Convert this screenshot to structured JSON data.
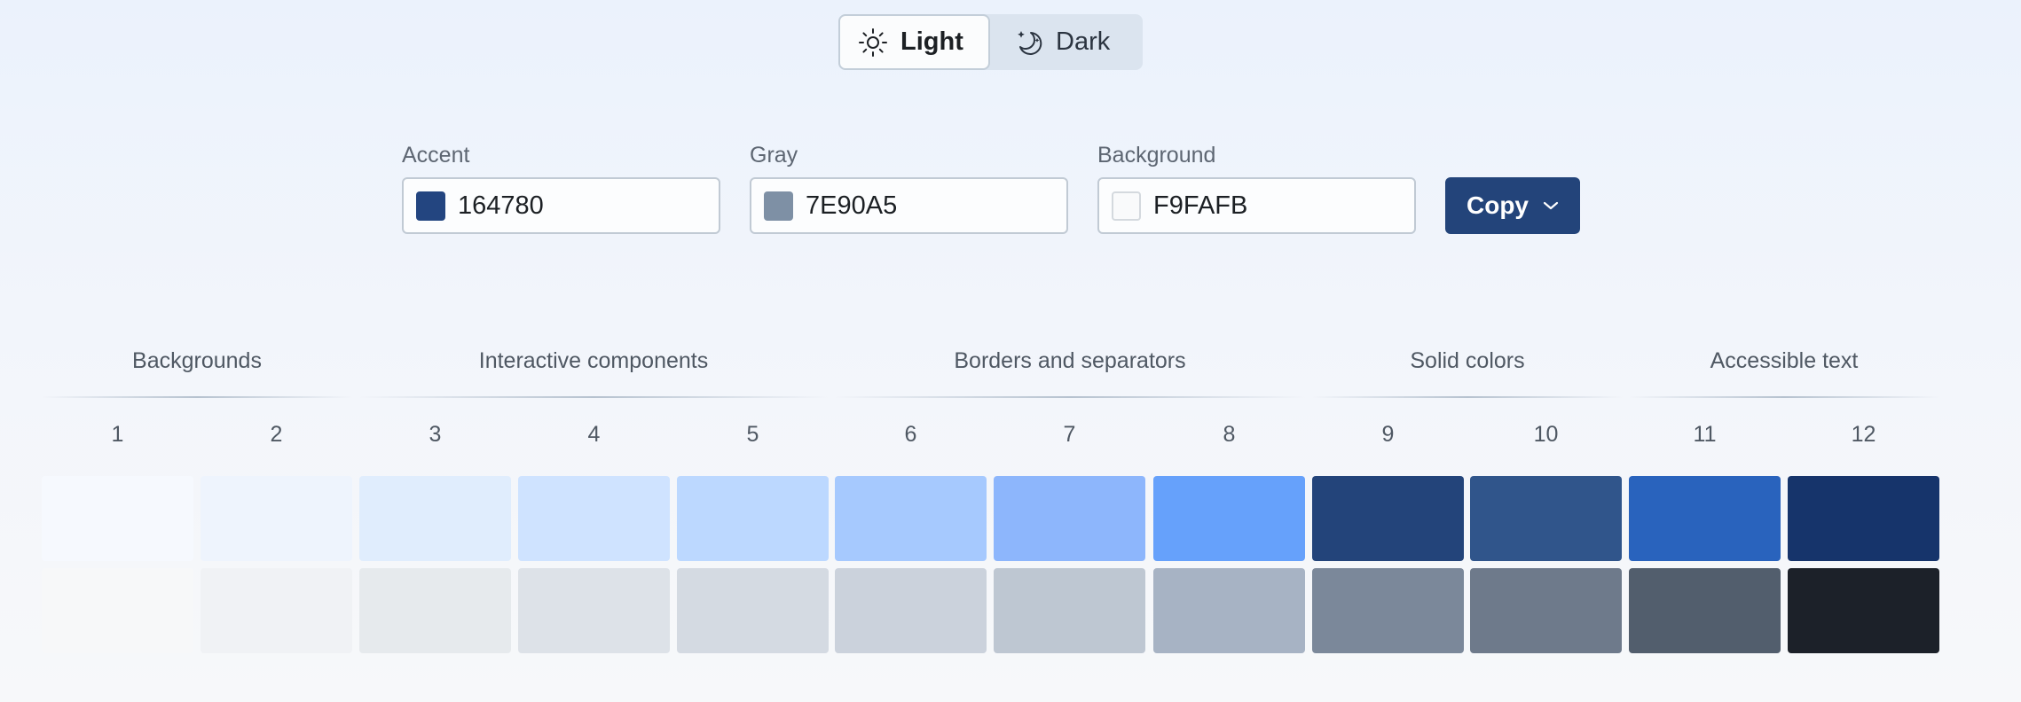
{
  "theme_toggle": {
    "light_label": "Light",
    "dark_label": "Dark",
    "selected": "Light"
  },
  "fields": {
    "accent": {
      "label": "Accent",
      "value": "164780",
      "swatch": "#234580"
    },
    "gray": {
      "label": "Gray",
      "value": "7E90A5",
      "swatch": "#7e90a5"
    },
    "background": {
      "label": "Background",
      "value": "F9FAFB",
      "swatch": "#f9fafb"
    }
  },
  "copy_button": {
    "label": "Copy"
  },
  "groups": [
    {
      "label": "Backgrounds"
    },
    {
      "label": "Interactive components"
    },
    {
      "label": "Borders and separators"
    },
    {
      "label": "Solid colors"
    },
    {
      "label": "Accessible text"
    }
  ],
  "steps": [
    "1",
    "2",
    "3",
    "4",
    "5",
    "6",
    "7",
    "8",
    "9",
    "10",
    "11",
    "12"
  ],
  "colors": {
    "accent_scale": [
      "#f6f9fe",
      "#eef4fd",
      "#e0edfd",
      "#cfe3ff",
      "#bcd8ff",
      "#a6c9fe",
      "#8db6fc",
      "#66a1fb",
      "#23447a",
      "#30558b",
      "#2963bd",
      "#16346b"
    ],
    "gray_scale": [
      "#f7f8f9",
      "#f0f2f5",
      "#e6eaed",
      "#dde2e8",
      "#d4dae2",
      "#cbd2dc",
      "#bec7d2",
      "#a7b3c4",
      "#7b889a",
      "#6e7a8b",
      "#525e6d",
      "#1c2129"
    ],
    "page_background_top": "#ebf2fc",
    "toggle_background": "#dbe4ef",
    "copy_button_background": "#23447a"
  }
}
